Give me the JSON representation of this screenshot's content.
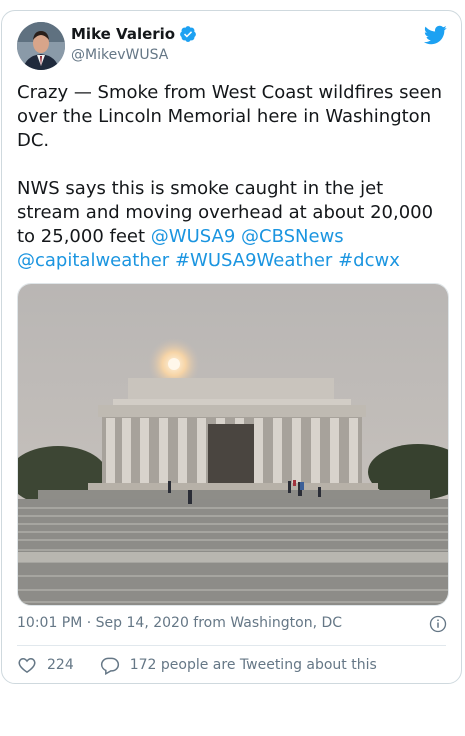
{
  "author": {
    "name": "Mike Valerio",
    "handle": "@MikevWUSA"
  },
  "tweet": {
    "para1": "Crazy — Smoke from West Coast wildfires seen over the Lincoln Memorial here in Washington DC.",
    "para2_text": "NWS says this is smoke caught in the jet stream and moving overhead at about 20,000 to 25,000 feet",
    "mentions": [
      "@WUSA9",
      "@CBSNews",
      "@capitalweather"
    ],
    "hashtags": [
      "#WUSA9Weather",
      "#dcwx"
    ]
  },
  "meta": {
    "timestamp": "10:01 PM · Sep 14, 2020 from Washington, DC"
  },
  "actions": {
    "likes": "224",
    "replies": "172 people are Tweeting about this"
  },
  "icons": {
    "verified": "verified-badge-icon",
    "bird": "twitter-bird-icon",
    "info": "info-icon",
    "heart": "heart-icon",
    "reply": "reply-bubble-icon"
  },
  "colors": {
    "link": "#1b95e0",
    "verified": "#1da1f2",
    "muted": "#657786"
  }
}
